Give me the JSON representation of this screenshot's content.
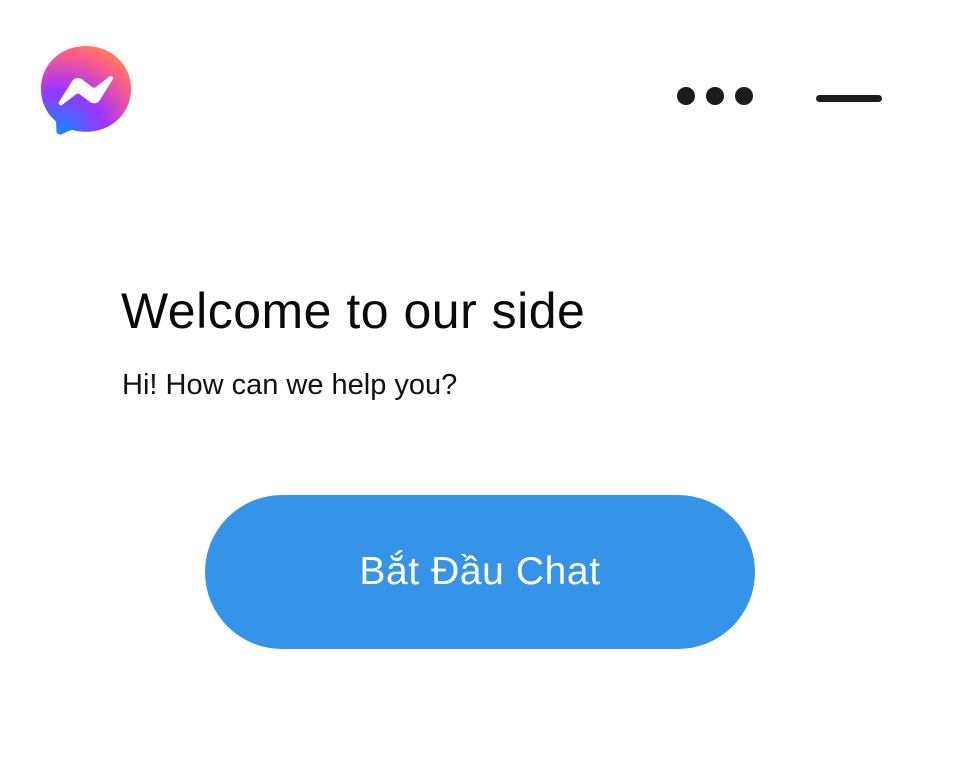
{
  "header": {
    "logo_icon": "messenger-icon",
    "more_icon": "more-horizontal-icon",
    "minimize_icon": "minimize-icon"
  },
  "main": {
    "title": "Welcome to our side",
    "subtitle": "Hi! How can we help you?",
    "start_chat_label": "Bắt Đầu Chat"
  },
  "colors": {
    "button_bg": "#3594e8",
    "button_text": "#ffffff",
    "icon_dark": "#1c1c1e",
    "logo_gradient": [
      "#0a8cff",
      "#a033ff",
      "#ff5c87",
      "#ff8c4a"
    ]
  }
}
